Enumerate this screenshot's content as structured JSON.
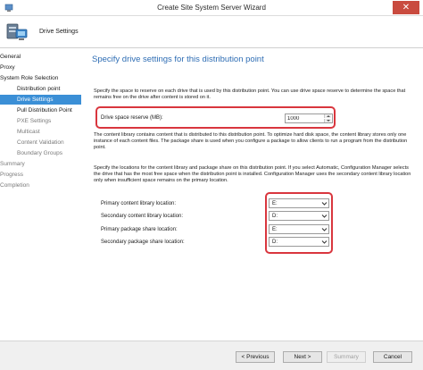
{
  "window": {
    "title": "Create Site System Server Wizard",
    "close_glyph": "✕"
  },
  "banner": {
    "title": "Drive Settings"
  },
  "nav": {
    "items": [
      {
        "label": "General"
      },
      {
        "label": "Proxy"
      },
      {
        "label": "System Role Selection"
      },
      {
        "label": "Distribution point"
      },
      {
        "label": "Drive Settings"
      },
      {
        "label": "Pull Distribution Point"
      },
      {
        "label": "PXE Settings"
      },
      {
        "label": "Multicast"
      },
      {
        "label": "Content Validation"
      },
      {
        "label": "Boundary Groups"
      },
      {
        "label": "Summary"
      },
      {
        "label": "Progress"
      },
      {
        "label": "Completion"
      }
    ]
  },
  "content": {
    "heading": "Specify drive settings for this distribution point",
    "para1": "Specify the space to reserve on each drive that is used by this distribution point. You can use drive space reserve to determine the space that remains free on the drive after content is stored on it.",
    "reserve_label": "Drive space reserve (MB):",
    "reserve_value": "1000",
    "para2": "The content library contains content that is distributed to this distribution point. To optimize hard disk space, the content library stores only one instance of each content files. The package share is used when you configure a package to allow clients to run a program from the distribution point.",
    "para3": "Specify the locations for the content library and package share on this distribution point. If you select Automatic, Configuration Manager selects the drive that has the most free space when the distribution point is installed. Configuration Manager uses the secondary content library location only when insufficient space remains on the primary location.",
    "locations": [
      {
        "label": "Primary content library location:",
        "value": "E:"
      },
      {
        "label": "Secondary content library location:",
        "value": "D:"
      },
      {
        "label": "Primary package share location:",
        "value": "E:"
      },
      {
        "label": "Secondary package share location:",
        "value": "D:"
      }
    ]
  },
  "footer": {
    "previous": "< Previous",
    "next": "Next >",
    "summary": "Summary",
    "cancel": "Cancel"
  },
  "colors": {
    "accent": "#3b8fd6",
    "heading": "#2e6db4",
    "highlight": "#d9363e",
    "close": "#c94b3f"
  },
  "icons": [
    "app-icon",
    "server-wizard-icon",
    "chevron-down-icon",
    "spin-up-icon",
    "spin-down-icon",
    "close-icon"
  ]
}
